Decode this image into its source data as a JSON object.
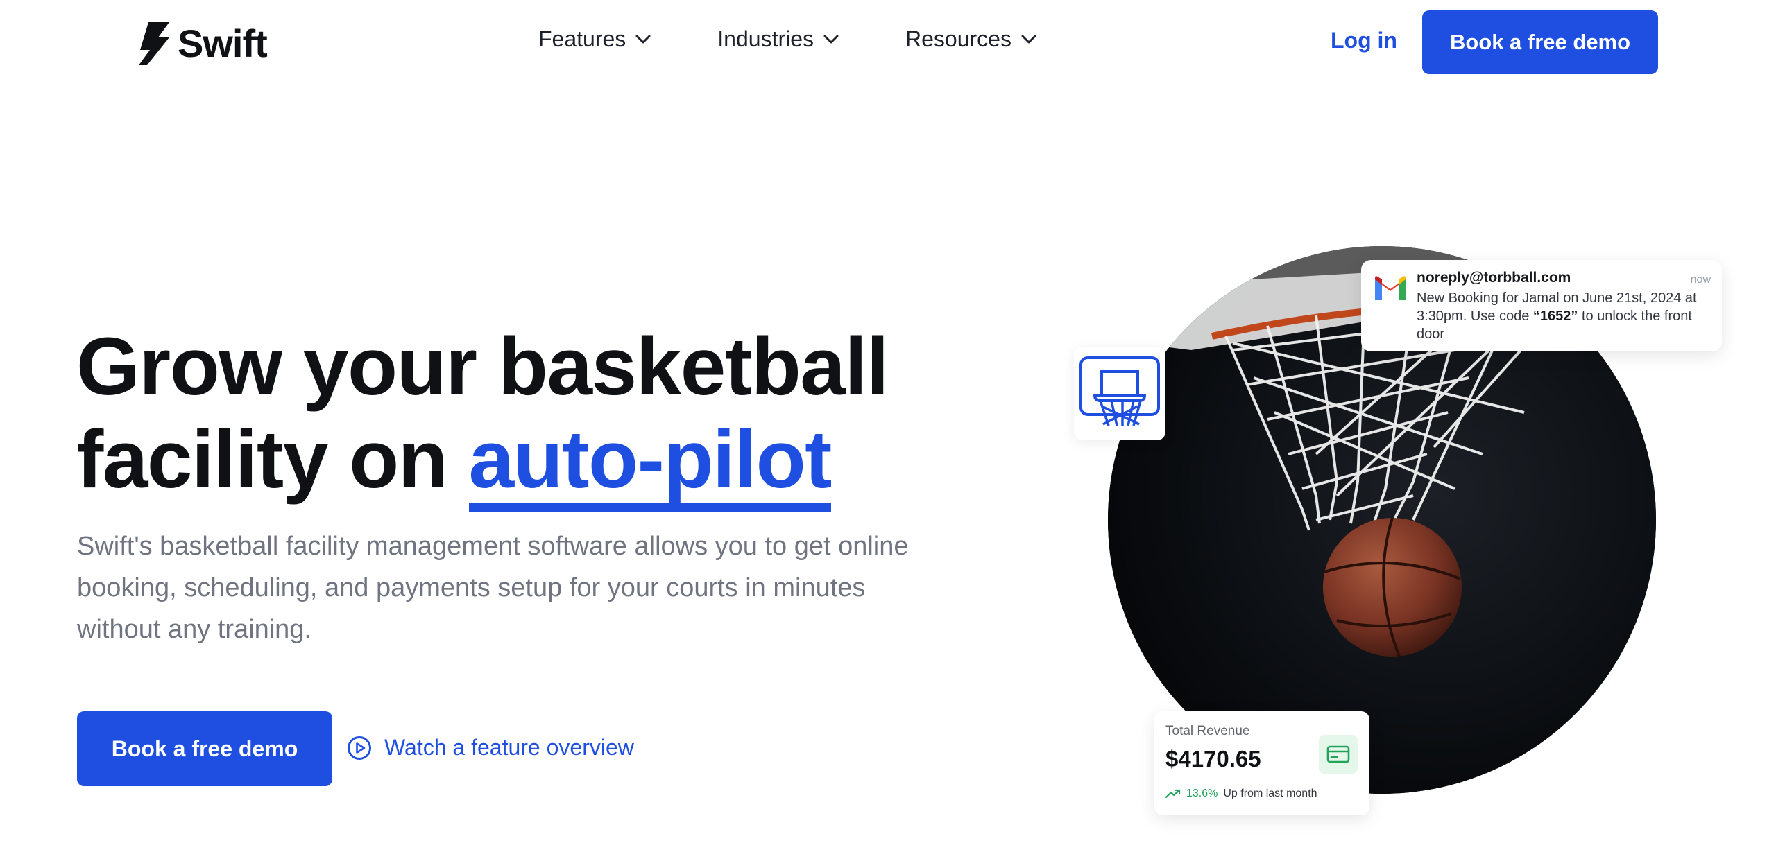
{
  "nav": {
    "brand": "Swift",
    "links": [
      {
        "label": "Features"
      },
      {
        "label": "Industries"
      },
      {
        "label": "Resources"
      }
    ],
    "login": "Log in",
    "cta": "Book a free demo"
  },
  "hero": {
    "title_line1": "Grow your basketball",
    "title_line2_prefix": "facility on ",
    "title_accent": "auto-pilot",
    "description": "Swift's basketball facility management software allows you to get online booking, scheduling, and payments setup for your courts in minutes without any training.",
    "cta": "Book a free demo",
    "watch_link": "Watch a feature overview"
  },
  "notification": {
    "from": "noreply@torbball.com",
    "time": "now",
    "body_prefix": "New Booking for Jamal on June 21st, 2024 at 3:30pm. Use code ",
    "code": "“1652”",
    "body_suffix": " to unlock the front door"
  },
  "revenue": {
    "label": "Total Revenue",
    "value": "$4170.65",
    "change": "13.6%",
    "change_text": "Up from last month"
  },
  "colors": {
    "accent": "#1f4fe0",
    "positive": "#22a35a"
  }
}
